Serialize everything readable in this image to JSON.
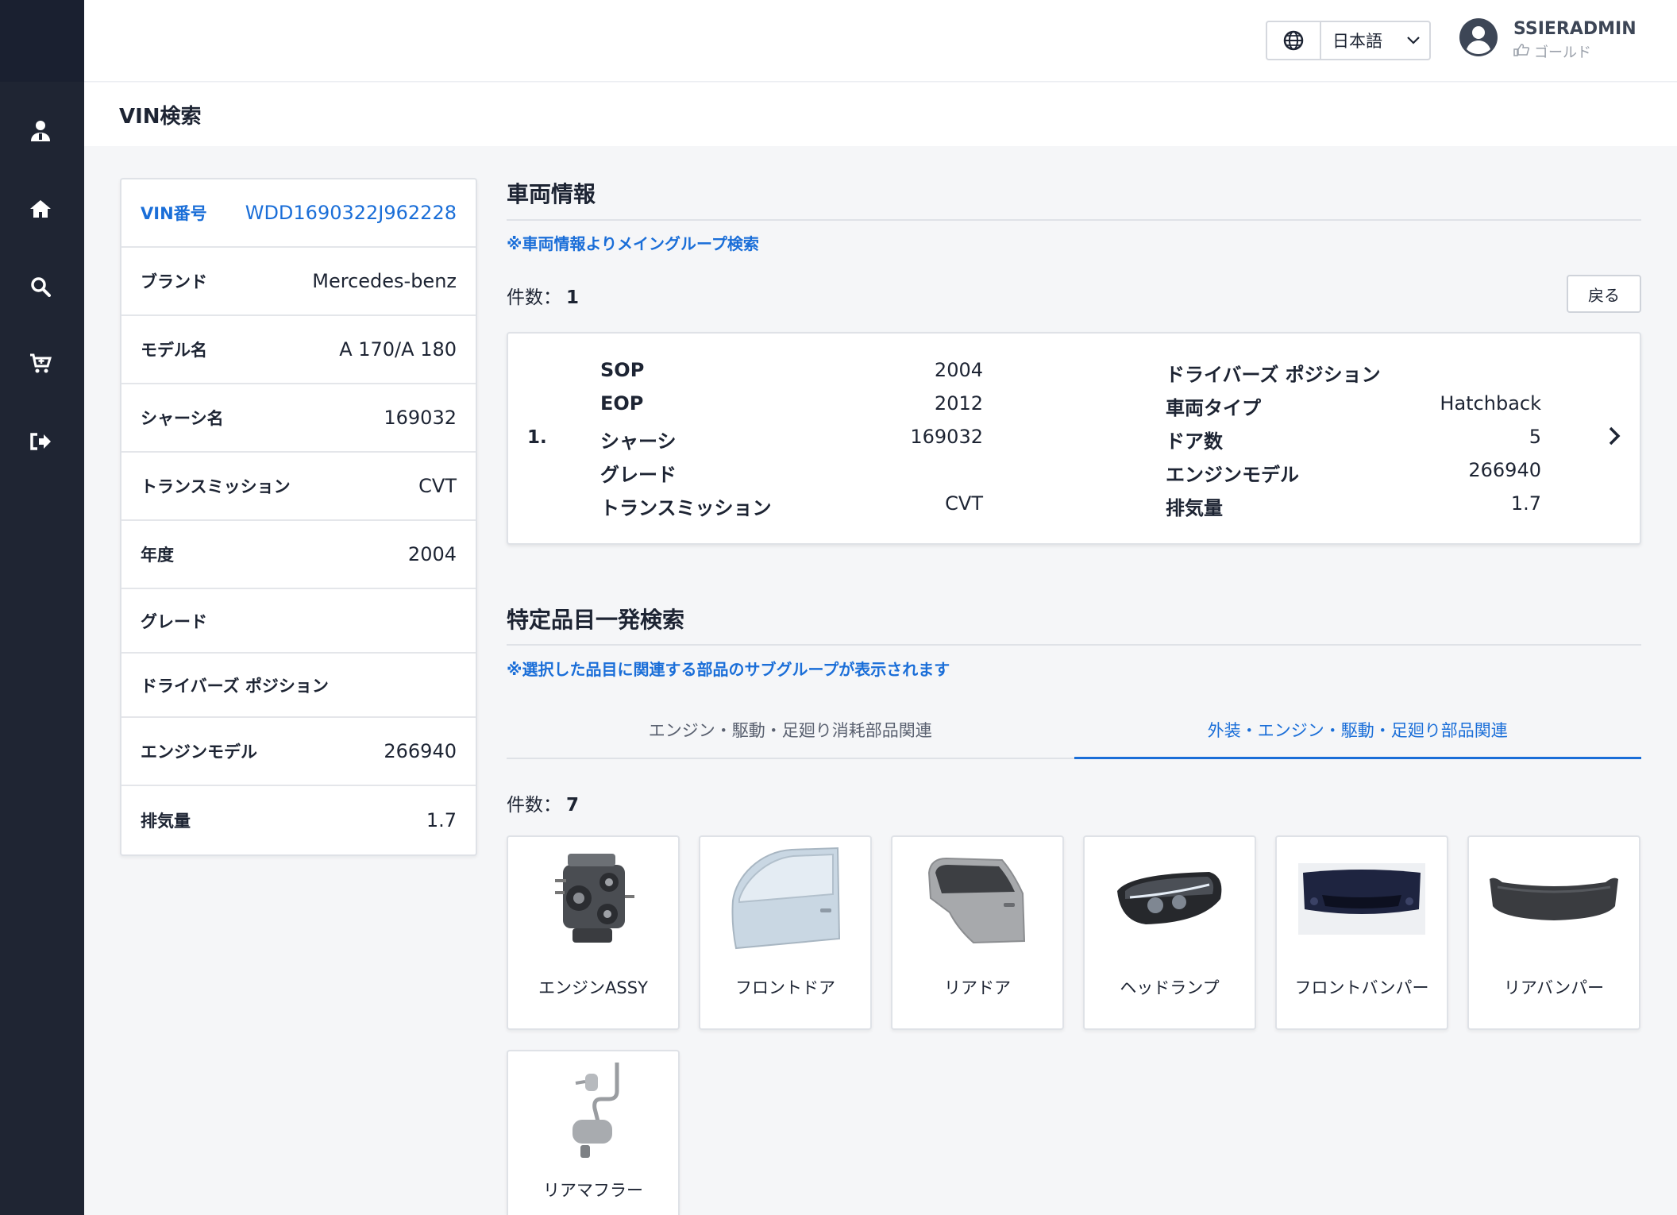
{
  "topbar": {
    "language": "日本語",
    "user_name": "SSIERADMIN",
    "user_rank": "ゴールド"
  },
  "page": {
    "title": "VIN検索"
  },
  "vin_card": {
    "rows": [
      {
        "label": "VIN番号",
        "value": "WDD1690322J962228"
      },
      {
        "label": "ブランド",
        "value": "Mercedes-benz"
      },
      {
        "label": "モデル名",
        "value": "A 170/A 180"
      },
      {
        "label": "シャーシ名",
        "value": "169032"
      },
      {
        "label": "トランスミッション",
        "value": "CVT"
      },
      {
        "label": "年度",
        "value": "2004"
      },
      {
        "label": "グレード",
        "value": ""
      },
      {
        "label": "ドライバーズ ポジション",
        "value": ""
      },
      {
        "label": "エンジンモデル",
        "value": "266940"
      },
      {
        "label": "排気量",
        "value": "1.7"
      }
    ]
  },
  "vehicle_info": {
    "title": "車両情報",
    "note": "※車両情報よりメイングループ検索",
    "count_label": "件数：",
    "count": "1",
    "back_label": "戻る",
    "result": {
      "index": "1.",
      "left": [
        {
          "label": "SOP",
          "value": "2004"
        },
        {
          "label": "EOP",
          "value": "2012"
        },
        {
          "label": "シャーシ",
          "value": "169032"
        },
        {
          "label": "グレード",
          "value": ""
        },
        {
          "label": "トランスミッション",
          "value": "CVT"
        }
      ],
      "right": [
        {
          "label": "ドライバーズ ポジション",
          "value": ""
        },
        {
          "label": "車両タイプ",
          "value": "Hatchback"
        },
        {
          "label": "ドア数",
          "value": "5"
        },
        {
          "label": "エンジンモデル",
          "value": "266940"
        },
        {
          "label": "排気量",
          "value": "1.7"
        }
      ]
    }
  },
  "parts_search": {
    "title": "特定品目一発検索",
    "note": "※選択した品目に関連する部品のサブグループが表示されます",
    "tabs": [
      {
        "label": "エンジン・駆動・足廻り消耗部品関連",
        "active": false
      },
      {
        "label": "外装・エンジン・駆動・足廻り部品関連",
        "active": true
      }
    ],
    "count_label": "件数：",
    "count": "7",
    "items": [
      {
        "name": "エンジンASSY",
        "icon": "engine-image"
      },
      {
        "name": "フロントドア",
        "icon": "front-door-image"
      },
      {
        "name": "リアドア",
        "icon": "rear-door-image"
      },
      {
        "name": "ヘッドランプ",
        "icon": "headlamp-image"
      },
      {
        "name": "フロントバンパー",
        "icon": "front-bumper-image"
      },
      {
        "name": "リアバンパー",
        "icon": "rear-bumper-image"
      },
      {
        "name": "リアマフラー",
        "icon": "rear-muffler-image"
      }
    ]
  },
  "colors": {
    "accent": "#1a6ed8",
    "sidebar": "#1f2533"
  }
}
